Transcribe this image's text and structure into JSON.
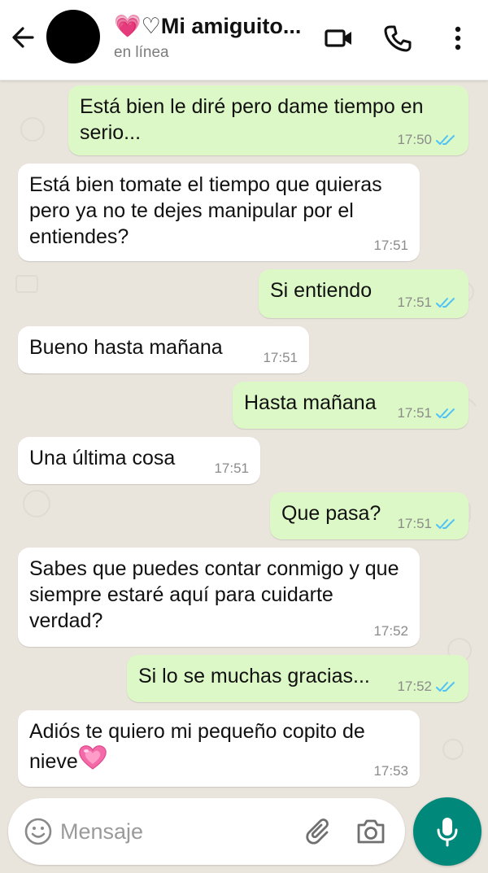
{
  "header": {
    "contact_name": "💗♡Mi amiguito...",
    "status": "en línea"
  },
  "messages": [
    {
      "dir": "out",
      "text": "Está bien le diré pero dame tiempo en serio...",
      "time": "17:50",
      "read": true
    },
    {
      "dir": "in",
      "text": "Está bien tomate el tiempo que quieras pero ya no te dejes manipular por el entiendes?",
      "time": "17:51"
    },
    {
      "dir": "out",
      "text": "Si entiendo",
      "time": "17:51",
      "read": true
    },
    {
      "dir": "in",
      "text": "Bueno hasta mañana",
      "time": "17:51"
    },
    {
      "dir": "out",
      "text": "Hasta mañana",
      "time": "17:51",
      "read": true
    },
    {
      "dir": "in",
      "text": "Una última cosa",
      "time": "17:51"
    },
    {
      "dir": "out",
      "text": "Que pasa?",
      "time": "17:51",
      "read": true
    },
    {
      "dir": "in",
      "text": "Sabes que puedes contar conmigo y que siempre estaré aquí para cuidarte verdad?",
      "time": "17:52"
    },
    {
      "dir": "out",
      "text": "Si lo se muchas gracias...",
      "time": "17:52",
      "read": true
    },
    {
      "dir": "in",
      "text": "Adiós te quiero mi pequeño copito de nieve",
      "time": "17:53",
      "emoji": "pink-heart"
    }
  ],
  "composer": {
    "placeholder": "Mensaje"
  },
  "colors": {
    "outgoing_bubble": "#dcf8c6",
    "incoming_bubble": "#ffffff",
    "chat_background": "#e9e4dc",
    "read_ticks": "#4fc3f7",
    "mic_button": "#00897b"
  },
  "icons": {
    "back": "arrow-left-icon",
    "video_call": "video-camera-icon",
    "voice_call": "phone-icon",
    "menu": "more-vertical-icon",
    "emoji": "emoji-smiley-icon",
    "attach": "paperclip-icon",
    "camera": "camera-icon",
    "mic": "microphone-icon"
  }
}
